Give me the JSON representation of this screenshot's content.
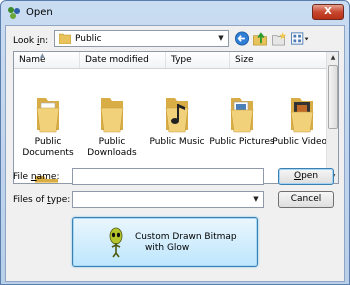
{
  "window": {
    "title": "Open",
    "close_glyph": "X"
  },
  "toolbar": {
    "look_in_label": "Look in:",
    "location": "Public",
    "icons": [
      "back-icon",
      "up-folder-icon",
      "new-folder-icon",
      "view-menu-icon"
    ]
  },
  "list": {
    "columns": [
      "Name",
      "Date modified",
      "Type",
      "Size"
    ],
    "items": [
      {
        "label": "Public Documents",
        "icon": "folder-icon"
      },
      {
        "label": "Public Downloads",
        "icon": "folder-icon"
      },
      {
        "label": "Public Music",
        "icon": "music-folder-icon"
      },
      {
        "label": "Public Pictures",
        "icon": "pictures-folder-icon"
      },
      {
        "label": "Public Videos",
        "icon": "videos-folder-icon"
      }
    ]
  },
  "file_name": {
    "label": "File name:",
    "value": ""
  },
  "file_type": {
    "label": "Files of type:",
    "value": ""
  },
  "buttons": {
    "open": "Open",
    "cancel": "Cancel"
  },
  "custom_button": {
    "line1": "Custom Drawn Bitmap",
    "line2": "with Glow"
  }
}
